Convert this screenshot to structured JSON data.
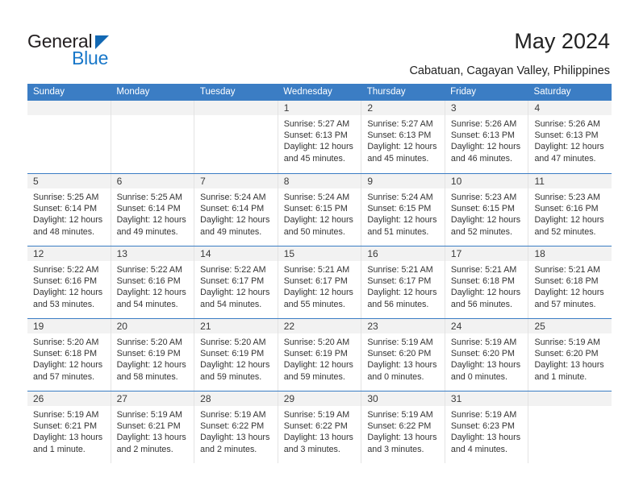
{
  "brand": {
    "name_part1": "General",
    "name_part2": "Blue",
    "triangle_icon": "triangle-icon",
    "color_dark": "#231f20",
    "color_blue": "#1877c9"
  },
  "header": {
    "title": "May 2024",
    "subtitle": "Cabatuan, Cagayan Valley, Philippines"
  },
  "theme": {
    "header_bar": "#3b7dc4",
    "row_divider": "#3b7dc4",
    "cell_divider": "#e3e3e3",
    "day_number_bg": "#f2f2f2",
    "text": "#333333"
  },
  "weekdays": [
    "Sunday",
    "Monday",
    "Tuesday",
    "Wednesday",
    "Thursday",
    "Friday",
    "Saturday"
  ],
  "weeks": [
    [
      {
        "day": "",
        "empty": true
      },
      {
        "day": "",
        "empty": true
      },
      {
        "day": "",
        "empty": true
      },
      {
        "day": "1",
        "sunrise": "Sunrise: 5:27 AM",
        "sunset": "Sunset: 6:13 PM",
        "daylight1": "Daylight: 12 hours",
        "daylight2": "and 45 minutes."
      },
      {
        "day": "2",
        "sunrise": "Sunrise: 5:27 AM",
        "sunset": "Sunset: 6:13 PM",
        "daylight1": "Daylight: 12 hours",
        "daylight2": "and 45 minutes."
      },
      {
        "day": "3",
        "sunrise": "Sunrise: 5:26 AM",
        "sunset": "Sunset: 6:13 PM",
        "daylight1": "Daylight: 12 hours",
        "daylight2": "and 46 minutes."
      },
      {
        "day": "4",
        "sunrise": "Sunrise: 5:26 AM",
        "sunset": "Sunset: 6:13 PM",
        "daylight1": "Daylight: 12 hours",
        "daylight2": "and 47 minutes."
      }
    ],
    [
      {
        "day": "5",
        "sunrise": "Sunrise: 5:25 AM",
        "sunset": "Sunset: 6:14 PM",
        "daylight1": "Daylight: 12 hours",
        "daylight2": "and 48 minutes."
      },
      {
        "day": "6",
        "sunrise": "Sunrise: 5:25 AM",
        "sunset": "Sunset: 6:14 PM",
        "daylight1": "Daylight: 12 hours",
        "daylight2": "and 49 minutes."
      },
      {
        "day": "7",
        "sunrise": "Sunrise: 5:24 AM",
        "sunset": "Sunset: 6:14 PM",
        "daylight1": "Daylight: 12 hours",
        "daylight2": "and 49 minutes."
      },
      {
        "day": "8",
        "sunrise": "Sunrise: 5:24 AM",
        "sunset": "Sunset: 6:15 PM",
        "daylight1": "Daylight: 12 hours",
        "daylight2": "and 50 minutes."
      },
      {
        "day": "9",
        "sunrise": "Sunrise: 5:24 AM",
        "sunset": "Sunset: 6:15 PM",
        "daylight1": "Daylight: 12 hours",
        "daylight2": "and 51 minutes."
      },
      {
        "day": "10",
        "sunrise": "Sunrise: 5:23 AM",
        "sunset": "Sunset: 6:15 PM",
        "daylight1": "Daylight: 12 hours",
        "daylight2": "and 52 minutes."
      },
      {
        "day": "11",
        "sunrise": "Sunrise: 5:23 AM",
        "sunset": "Sunset: 6:16 PM",
        "daylight1": "Daylight: 12 hours",
        "daylight2": "and 52 minutes."
      }
    ],
    [
      {
        "day": "12",
        "sunrise": "Sunrise: 5:22 AM",
        "sunset": "Sunset: 6:16 PM",
        "daylight1": "Daylight: 12 hours",
        "daylight2": "and 53 minutes."
      },
      {
        "day": "13",
        "sunrise": "Sunrise: 5:22 AM",
        "sunset": "Sunset: 6:16 PM",
        "daylight1": "Daylight: 12 hours",
        "daylight2": "and 54 minutes."
      },
      {
        "day": "14",
        "sunrise": "Sunrise: 5:22 AM",
        "sunset": "Sunset: 6:17 PM",
        "daylight1": "Daylight: 12 hours",
        "daylight2": "and 54 minutes."
      },
      {
        "day": "15",
        "sunrise": "Sunrise: 5:21 AM",
        "sunset": "Sunset: 6:17 PM",
        "daylight1": "Daylight: 12 hours",
        "daylight2": "and 55 minutes."
      },
      {
        "day": "16",
        "sunrise": "Sunrise: 5:21 AM",
        "sunset": "Sunset: 6:17 PM",
        "daylight1": "Daylight: 12 hours",
        "daylight2": "and 56 minutes."
      },
      {
        "day": "17",
        "sunrise": "Sunrise: 5:21 AM",
        "sunset": "Sunset: 6:18 PM",
        "daylight1": "Daylight: 12 hours",
        "daylight2": "and 56 minutes."
      },
      {
        "day": "18",
        "sunrise": "Sunrise: 5:21 AM",
        "sunset": "Sunset: 6:18 PM",
        "daylight1": "Daylight: 12 hours",
        "daylight2": "and 57 minutes."
      }
    ],
    [
      {
        "day": "19",
        "sunrise": "Sunrise: 5:20 AM",
        "sunset": "Sunset: 6:18 PM",
        "daylight1": "Daylight: 12 hours",
        "daylight2": "and 57 minutes."
      },
      {
        "day": "20",
        "sunrise": "Sunrise: 5:20 AM",
        "sunset": "Sunset: 6:19 PM",
        "daylight1": "Daylight: 12 hours",
        "daylight2": "and 58 minutes."
      },
      {
        "day": "21",
        "sunrise": "Sunrise: 5:20 AM",
        "sunset": "Sunset: 6:19 PM",
        "daylight1": "Daylight: 12 hours",
        "daylight2": "and 59 minutes."
      },
      {
        "day": "22",
        "sunrise": "Sunrise: 5:20 AM",
        "sunset": "Sunset: 6:19 PM",
        "daylight1": "Daylight: 12 hours",
        "daylight2": "and 59 minutes."
      },
      {
        "day": "23",
        "sunrise": "Sunrise: 5:19 AM",
        "sunset": "Sunset: 6:20 PM",
        "daylight1": "Daylight: 13 hours",
        "daylight2": "and 0 minutes."
      },
      {
        "day": "24",
        "sunrise": "Sunrise: 5:19 AM",
        "sunset": "Sunset: 6:20 PM",
        "daylight1": "Daylight: 13 hours",
        "daylight2": "and 0 minutes."
      },
      {
        "day": "25",
        "sunrise": "Sunrise: 5:19 AM",
        "sunset": "Sunset: 6:20 PM",
        "daylight1": "Daylight: 13 hours",
        "daylight2": "and 1 minute."
      }
    ],
    [
      {
        "day": "26",
        "sunrise": "Sunrise: 5:19 AM",
        "sunset": "Sunset: 6:21 PM",
        "daylight1": "Daylight: 13 hours",
        "daylight2": "and 1 minute."
      },
      {
        "day": "27",
        "sunrise": "Sunrise: 5:19 AM",
        "sunset": "Sunset: 6:21 PM",
        "daylight1": "Daylight: 13 hours",
        "daylight2": "and 2 minutes."
      },
      {
        "day": "28",
        "sunrise": "Sunrise: 5:19 AM",
        "sunset": "Sunset: 6:22 PM",
        "daylight1": "Daylight: 13 hours",
        "daylight2": "and 2 minutes."
      },
      {
        "day": "29",
        "sunrise": "Sunrise: 5:19 AM",
        "sunset": "Sunset: 6:22 PM",
        "daylight1": "Daylight: 13 hours",
        "daylight2": "and 3 minutes."
      },
      {
        "day": "30",
        "sunrise": "Sunrise: 5:19 AM",
        "sunset": "Sunset: 6:22 PM",
        "daylight1": "Daylight: 13 hours",
        "daylight2": "and 3 minutes."
      },
      {
        "day": "31",
        "sunrise": "Sunrise: 5:19 AM",
        "sunset": "Sunset: 6:23 PM",
        "daylight1": "Daylight: 13 hours",
        "daylight2": "and 4 minutes."
      },
      {
        "day": "",
        "empty": true
      }
    ]
  ]
}
